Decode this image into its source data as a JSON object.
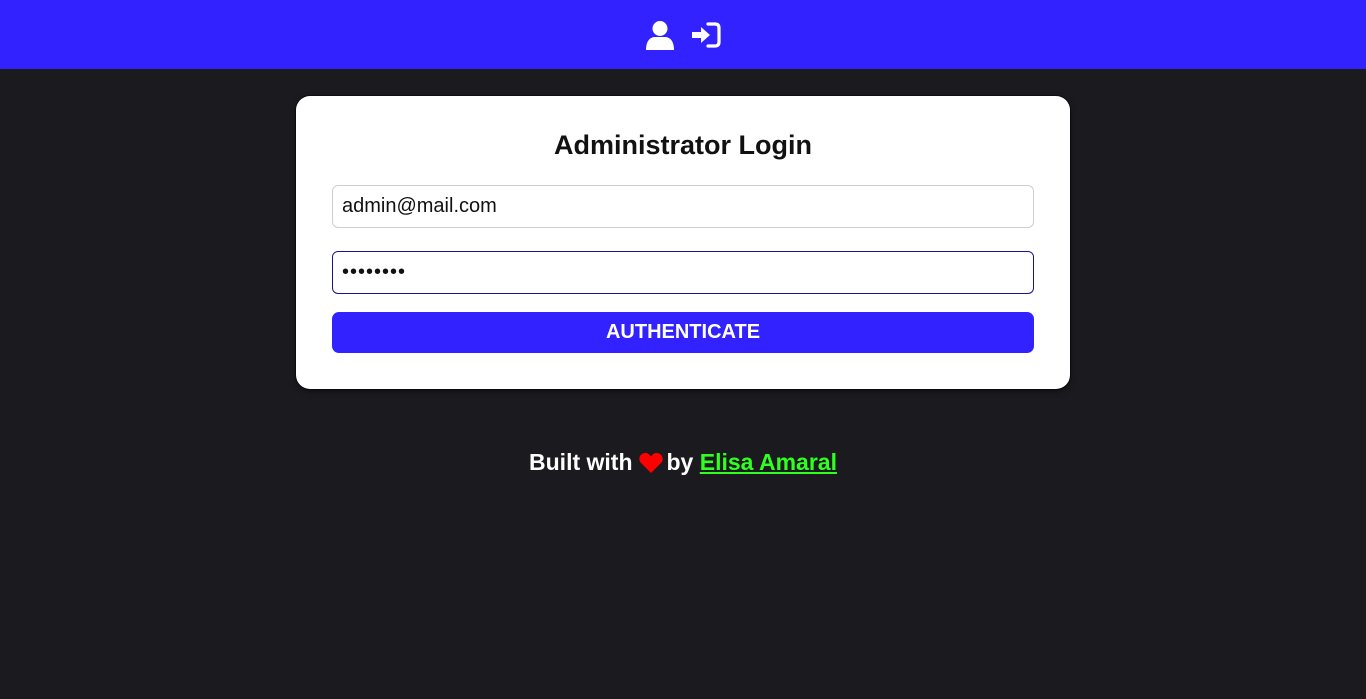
{
  "header": {
    "background_color": "#3122ff",
    "icons": [
      {
        "name": "user-icon",
        "color": "#ffffff"
      },
      {
        "name": "sign-in-icon",
        "color": "#ffffff"
      }
    ]
  },
  "login": {
    "title": "Administrator Login",
    "email_value": "admin@mail.com",
    "password_value": "password",
    "button_label": "AUTHENTICATE",
    "button_color": "#3122ff"
  },
  "footer": {
    "built_with": "Built with",
    "heart_icon": "heart-icon",
    "heart_color": "#ff0000",
    "by": "by",
    "author": "Elisa Amaral",
    "author_color": "#31ff21"
  },
  "page": {
    "background_color": "#1b1a1f"
  }
}
